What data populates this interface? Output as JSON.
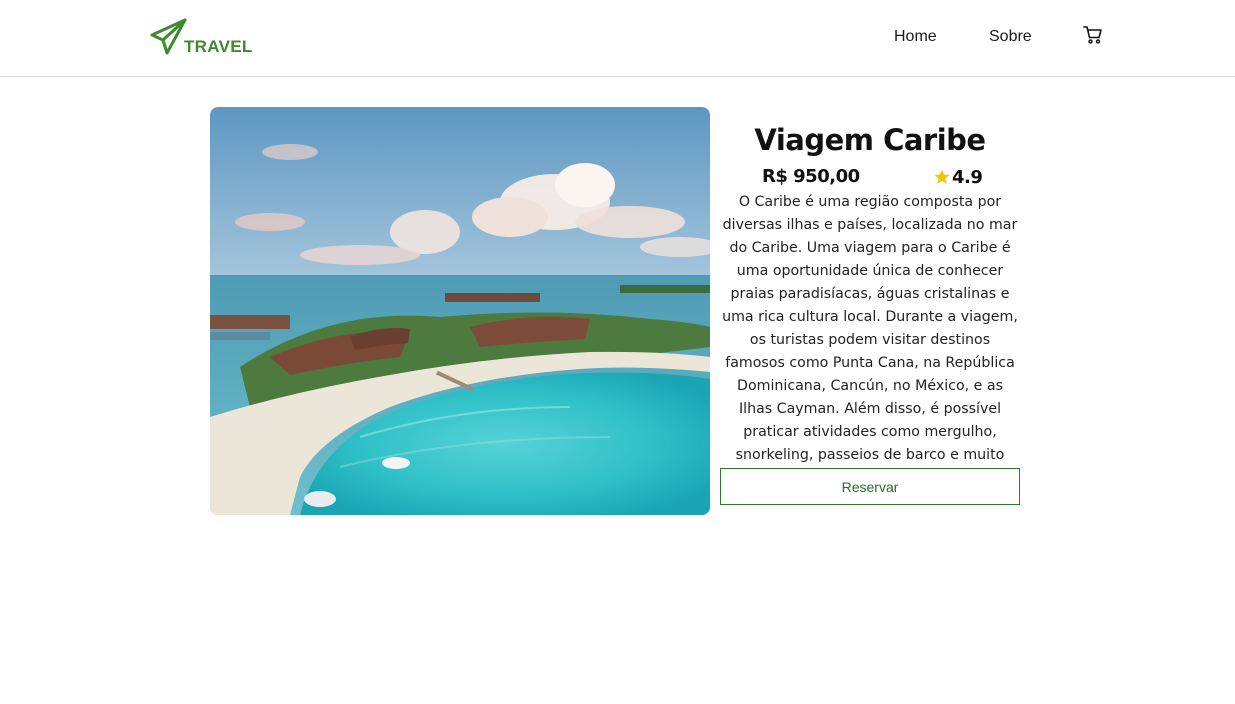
{
  "header": {
    "logo_text": "TRAVEL",
    "nav": {
      "home_label": "Home",
      "sobre_label": "Sobre"
    },
    "cart_icon": "cart-icon"
  },
  "colors": {
    "brand_green": "#3d8a2f",
    "button_border": "#2f7a2a",
    "star": "#f2c511",
    "divider": "#d9d9d9"
  },
  "product": {
    "image_alt": "Caribbean island resort with turquoise water",
    "title": "Viagem Caribe",
    "price": "R$ 950,00",
    "rating": "4.9",
    "rating_icon": "star-icon",
    "description": "O Caribe é uma região composta por diversas ilhas e países, localizada no mar do Caribe. Uma viagem para o Caribe é uma oportunidade única de conhecer praias paradisíacas, águas cristalinas e uma rica cultura local. Durante a viagem, os turistas podem visitar destinos famosos como Punta Cana, na República Dominicana, Cancún, no México, e as Ilhas Cayman. Além disso, é possível praticar atividades como mergulho, snorkeling, passeios de barco e muito mais.",
    "reserve_label": "Reservar"
  }
}
